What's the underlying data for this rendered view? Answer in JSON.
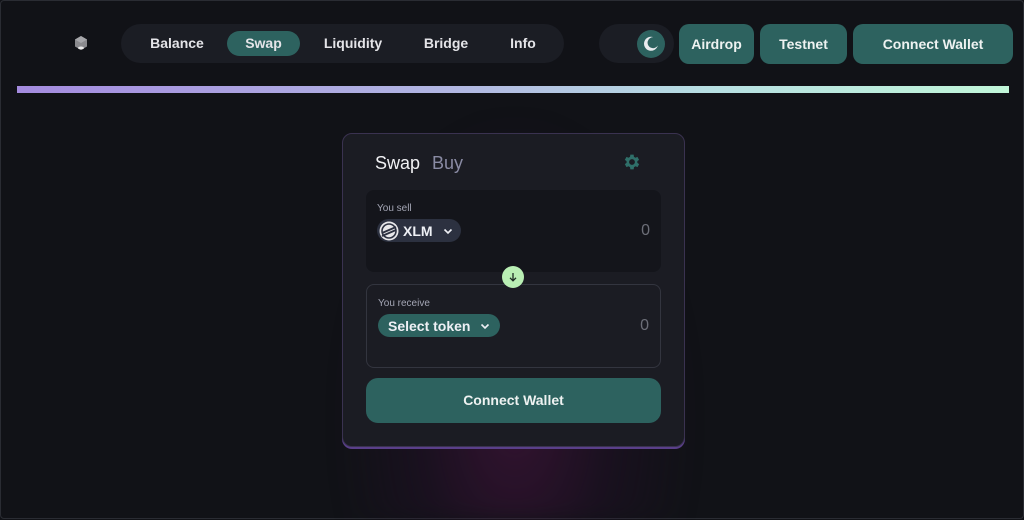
{
  "header": {
    "logo_icon": "cube-icon",
    "nav": [
      {
        "label": "Balance",
        "active": false
      },
      {
        "label": "Swap",
        "active": true
      },
      {
        "label": "Liquidity",
        "active": false
      },
      {
        "label": "Bridge",
        "active": false
      },
      {
        "label": "Info",
        "active": false
      }
    ],
    "theme_icon": "moon-icon",
    "airdrop_label": "Airdrop",
    "testnet_label": "Testnet",
    "connect_wallet_label": "Connect Wallet"
  },
  "colors": {
    "accent": "#2d625f",
    "background": "#111217",
    "card": "#1b1c23",
    "swap_arrow": "#b9efb4",
    "gradient_start": "#a48bdf",
    "gradient_end": "#c1f6d9"
  },
  "swap_card": {
    "tabs": [
      {
        "label": "Swap",
        "active": true
      },
      {
        "label": "Buy",
        "active": false
      }
    ],
    "settings_icon": "gear-icon",
    "sell": {
      "label": "You sell",
      "token": "XLM",
      "token_icon": "stellar-icon",
      "amount": "0"
    },
    "swap_direction_icon": "arrow-down-icon",
    "receive": {
      "label": "You receive",
      "token": "Select token",
      "amount": "0"
    },
    "connect_wallet_label": "Connect Wallet"
  }
}
